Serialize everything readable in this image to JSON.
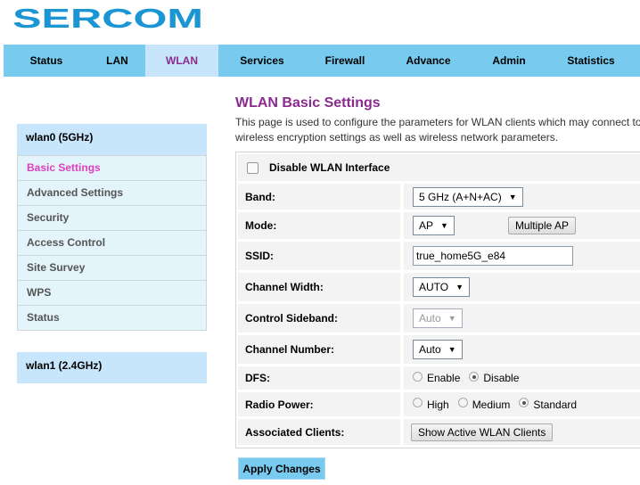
{
  "logo": "SERCOM",
  "nav": [
    {
      "label": "Status"
    },
    {
      "label": "LAN"
    },
    {
      "label": "WLAN"
    },
    {
      "label": "Services"
    },
    {
      "label": "Firewall"
    },
    {
      "label": "Advance"
    },
    {
      "label": "Admin"
    },
    {
      "label": "Statistics"
    }
  ],
  "sidebar": {
    "wlan0": "wlan0 (5GHz)",
    "items": [
      "Basic Settings",
      "Advanced Settings",
      "Security",
      "Access Control",
      "Site Survey",
      "WPS",
      "Status"
    ],
    "wlan1": "wlan1 (2.4GHz)"
  },
  "page": {
    "title": "WLAN Basic Settings",
    "desc1": "This page is used to configure the parameters for WLAN clients which may connect to",
    "desc2": "wireless encryption settings as well as wireless network parameters."
  },
  "form": {
    "disable_label": "Disable WLAN Interface",
    "band_label": "Band:",
    "band_value": "5 GHz (A+N+AC)",
    "mode_label": "Mode:",
    "mode_value": "AP",
    "multiple_ap": "Multiple AP",
    "ssid_label": "SSID:",
    "ssid_value": "true_home5G_e84",
    "cw_label": "Channel Width:",
    "cw_value": "AUTO",
    "cs_label": "Control Sideband:",
    "cs_value": "Auto",
    "cn_label": "Channel Number:",
    "cn_value": "Auto",
    "dfs_label": "DFS:",
    "dfs_enable": "Enable",
    "dfs_disable": "Disable",
    "rp_label": "Radio Power:",
    "rp_high": "High",
    "rp_medium": "Medium",
    "rp_standard": "Standard",
    "ac_label": "Associated Clients:",
    "ac_button": "Show Active WLAN Clients",
    "apply": "Apply Changes",
    "arrow": "▼"
  }
}
